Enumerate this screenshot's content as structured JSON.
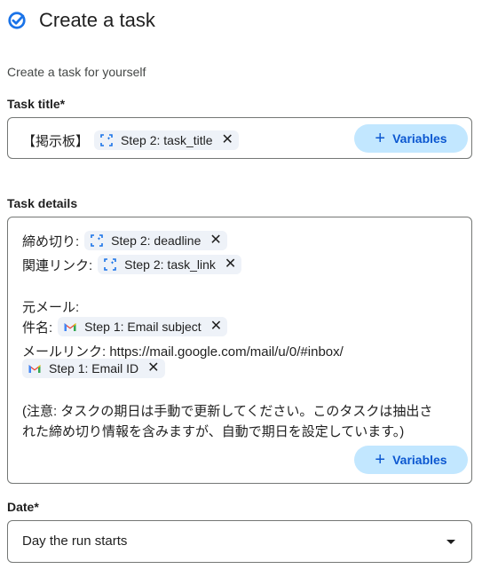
{
  "header": {
    "title": "Create a task",
    "logo_icon": "tasks-check-icon"
  },
  "subtitle": "Create a task for yourself",
  "task_title": {
    "label": "Task title*",
    "prefix": "【掲示板】",
    "chip": "Step 2: task_title",
    "variables_button": "Variables"
  },
  "task_details": {
    "label": "Task details",
    "line1_prefix": "締め切り:",
    "line1_chip": "Step 2: deadline",
    "line2_prefix": "関連リンク:",
    "line2_chip": "Step 2: task_link",
    "line3": "元メール:",
    "line4_prefix": "件名:",
    "line4_chip": "Step 1: Email subject",
    "line5": "メールリンク: https://mail.google.com/mail/u/0/#inbox/",
    "line6_chip": "Step 1: Email ID",
    "note_line1": "(注意: タスクの期日は手動で更新してください。このタスクは抽出さ",
    "note_line2": "れた締め切り情報を含みますが、自動で期日を設定しています。)",
    "variables_button": "Variables"
  },
  "date": {
    "label": "Date*",
    "value": "Day the run starts"
  },
  "colors": {
    "accent": "#0b57d0",
    "chip_bg": "#eef2f8",
    "button_bg": "#c2e7ff"
  }
}
